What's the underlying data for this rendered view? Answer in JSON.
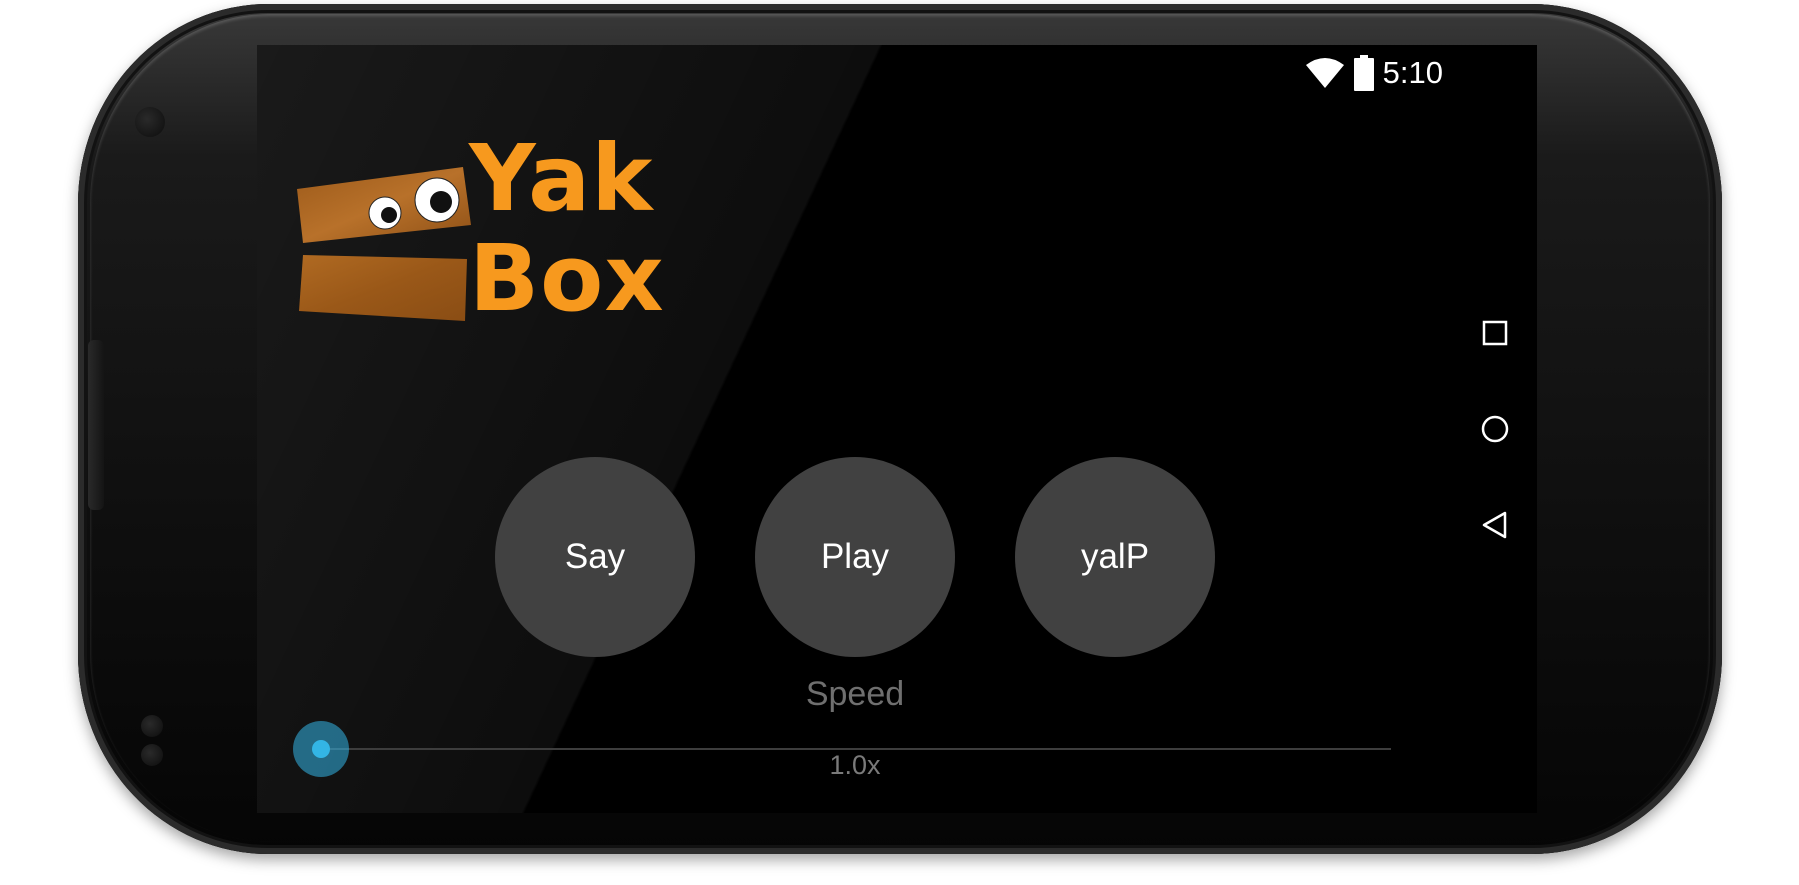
{
  "status_bar": {
    "time": "5:10",
    "wifi_icon": "wifi-icon",
    "battery_icon": "battery-icon"
  },
  "logo": {
    "line1": "Yak",
    "line2": "Box",
    "accent_color": "#f7991e",
    "box_color": "#a8641c"
  },
  "buttons": {
    "say": "Say",
    "play": "Play",
    "yalp": "yalP"
  },
  "speed": {
    "label": "Speed",
    "value_text": "1.0x",
    "slider_position": 0,
    "accent_color": "#33b5e5"
  },
  "nav_bar": {
    "recent_icon": "recent-apps-icon",
    "home_icon": "home-icon",
    "back_icon": "back-icon"
  },
  "colors": {
    "screen_bg": "#000000",
    "button_bg": "#414141"
  }
}
